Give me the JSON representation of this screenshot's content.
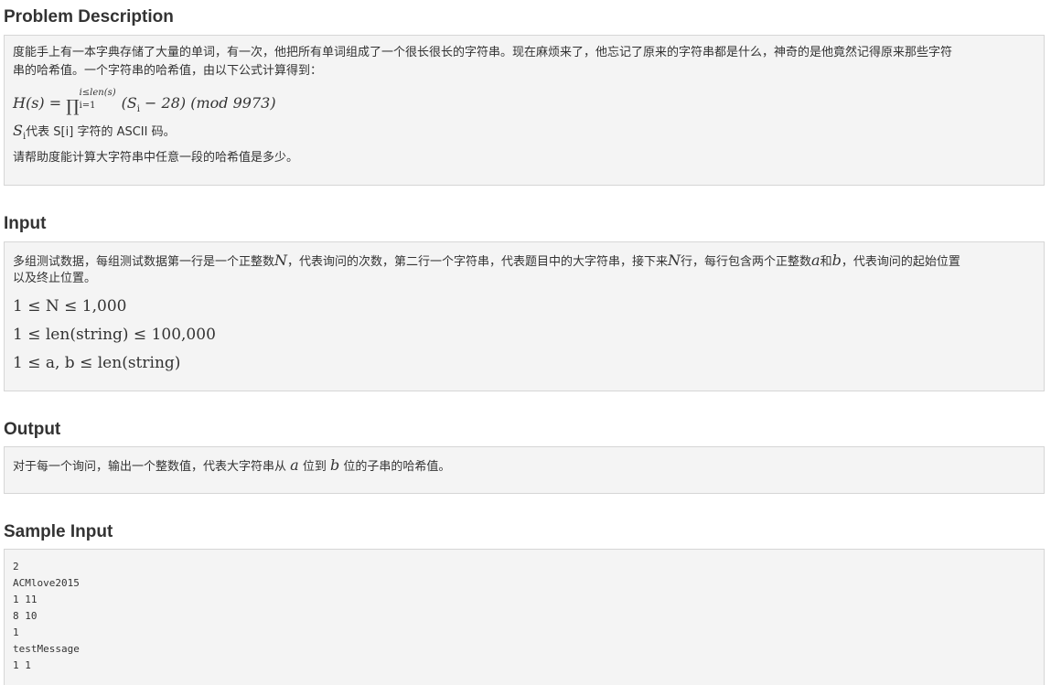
{
  "sections": {
    "problem_description": {
      "title": "Problem Description",
      "paragraph_1": "度能手上有一本字典存储了大量的单词，有一次，他把所有单词组成了一个很长很长的字符串。现在麻烦来了，他忘记了原来的字符串都是什么，神奇的是他竟然记得原来那些字符",
      "paragraph_1b": "串的哈希值。一个字符串的哈希值，由以下公式计算得到：",
      "formula": {
        "lhs": "H(s) = ",
        "upper_limit": "i≤len(s)",
        "lower_limit": "i=1",
        "body": "(S",
        "body_sub": "i",
        "body_tail": " − 28) (mod 9973)"
      },
      "si_symbol": "S",
      "si_sub": "i",
      "si_text": "代表 S[i] 字符的 ASCII 码。",
      "paragraph_3": "请帮助度能计算大字符串中任意一段的哈希值是多少。"
    },
    "input": {
      "title": "Input",
      "text_a": "多组测试数据，每组测试数据第一行是一个正整数",
      "var_n": "N",
      "text_b": "，代表询问的次数，第二行一个字符串，代表题目中的大字符串，接下来",
      "var_n2": "N",
      "text_c": "行，每行包含两个正整数",
      "var_a": "a",
      "text_d": "和",
      "var_b": "b",
      "text_e": "，代表询问的起始位置",
      "text_f": "以及终止位置。",
      "constraint_1": "1 ≤ N ≤ 1,000",
      "constraint_2": "1 ≤ len(string) ≤ 100,000",
      "constraint_3": "1 ≤ a, b ≤ len(string)"
    },
    "output": {
      "title": "Output",
      "text_a": "对于每一个询问，输出一个整数值，代表大字符串从 ",
      "var_a": "a",
      "text_b": " 位到 ",
      "var_b": "b",
      "text_c": " 位的子串的哈希值。"
    },
    "sample_input": {
      "title": "Sample Input",
      "code": "2\nACMlove2015\n1 11\n8 10\n1\ntestMessage\n1 1"
    }
  }
}
